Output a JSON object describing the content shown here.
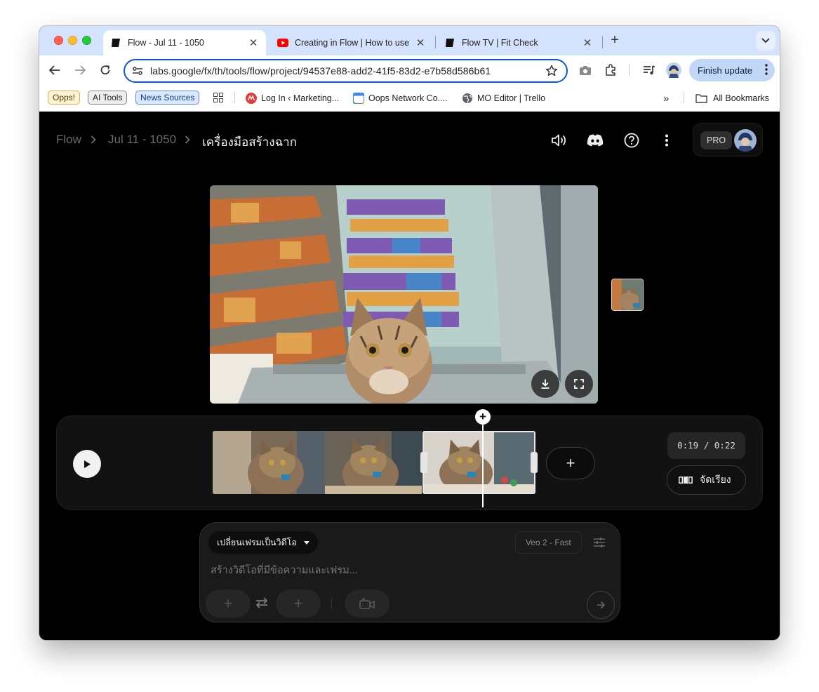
{
  "browser": {
    "tabs": [
      {
        "title": "Flow - Jul 11 - 1050",
        "favicon": "flow-icon",
        "active": true
      },
      {
        "title": "Creating in Flow | How to use",
        "favicon": "youtube-icon",
        "active": false
      },
      {
        "title": "Flow TV | Fit Check",
        "favicon": "flow-icon",
        "active": false
      }
    ],
    "url": "labs.google/fx/th/tools/flow/project/94537e88-add2-41f5-83d2-e7b58d586b61",
    "finish_update_label": "Finish update",
    "bookmarks": {
      "chips": [
        "Opps!",
        "AI Tools",
        "News Sources"
      ],
      "items": [
        "Log In ‹ Marketing...",
        "Oops Network Co....",
        "MO Editor | Trello"
      ],
      "all_bookmarks": "All Bookmarks"
    }
  },
  "app": {
    "breadcrumb": [
      "Flow",
      "Jul 11 - 1050",
      "เครื่องมือสร้างฉาก"
    ],
    "pro_badge": "PRO",
    "timeline": {
      "time_display": "0:19 / 0:22",
      "arrange_label": "จัดเรียง",
      "clip_count": 3,
      "selected_clip": 3
    },
    "prompt": {
      "mode_label": "เปลี่ยนเฟรมเป็นวิดีโอ",
      "model_label": "Veo 2 - Fast",
      "placeholder": "สร้างวิดีโอที่มีข้อความและเฟรม..."
    }
  },
  "colors": {
    "tab_strip": "#d3e3fd",
    "accent": "#0b57d0",
    "app_background": "#000000"
  }
}
